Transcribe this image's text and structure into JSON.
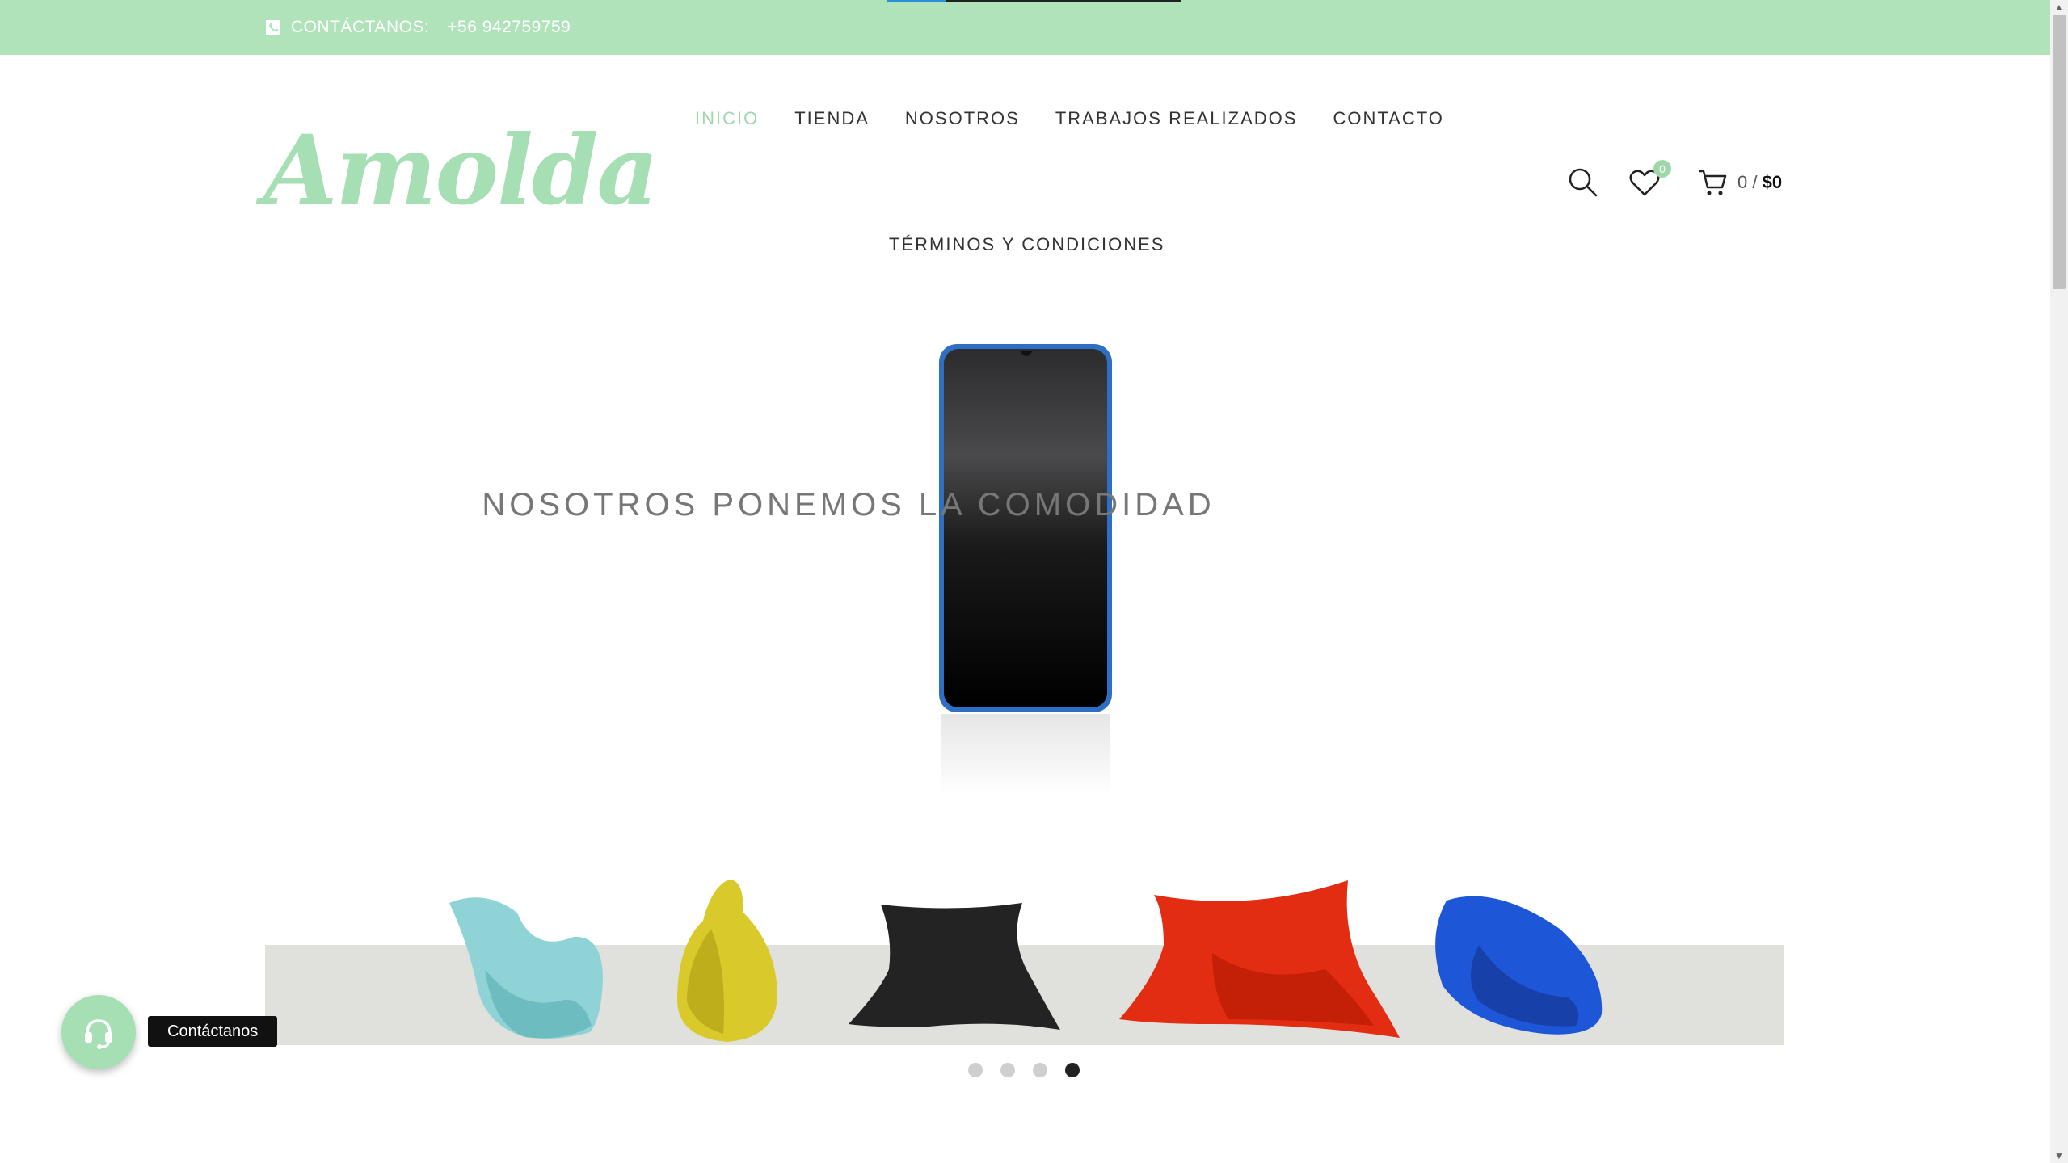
{
  "topbar": {
    "contact_label": "CONTÁCTANOS:",
    "phone": "+56 942759759"
  },
  "brand": {
    "logo_text": "Amolda"
  },
  "nav": {
    "items": [
      {
        "label": "INICIO",
        "active": true
      },
      {
        "label": "TIENDA"
      },
      {
        "label": "NOSOTROS"
      },
      {
        "label": "TRABAJOS REALIZADOS"
      },
      {
        "label": "CONTACTO"
      }
    ],
    "row2": "TÉRMINOS Y CONDICIONES"
  },
  "tools": {
    "wishlist_count": "0",
    "cart_count": "0",
    "cart_separator": "/",
    "cart_total": "$0"
  },
  "slider": {
    "caption": "NOSOTROS PONEMOS LA COMODIDAD",
    "dots": 4,
    "active_dot": 4
  },
  "floating": {
    "label": "Contáctanos"
  },
  "colors": {
    "accent": "#a6dfb3",
    "topbar_bg": "#b1e3bb",
    "active_nav": "#9ed7aa"
  }
}
